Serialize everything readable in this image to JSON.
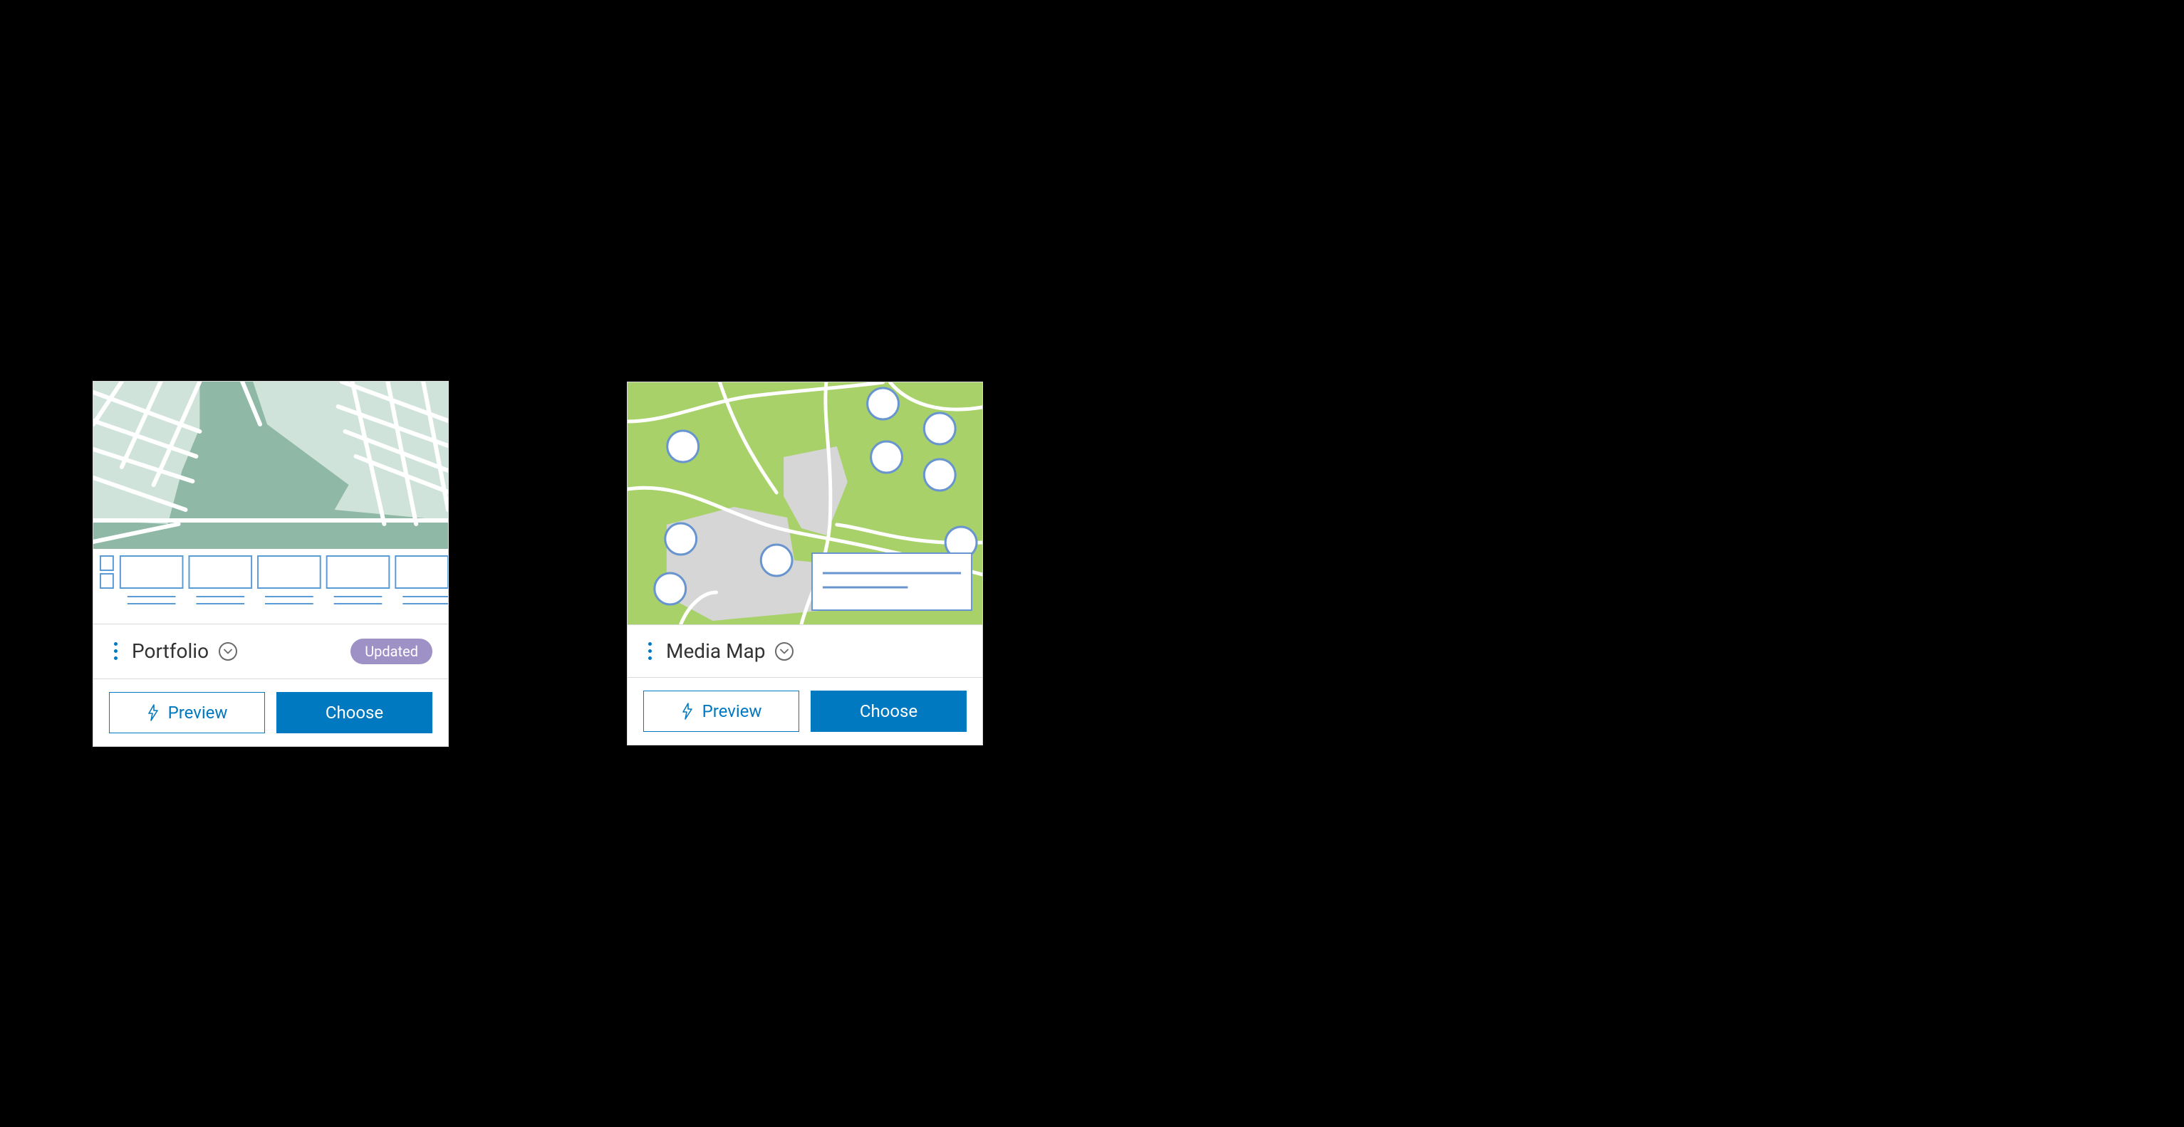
{
  "cards": [
    {
      "title": "Portfolio",
      "badge": "Updated",
      "preview_label": "Preview",
      "choose_label": "Choose"
    },
    {
      "title": "Media Map",
      "badge": null,
      "preview_label": "Preview",
      "choose_label": "Choose"
    }
  ],
  "colors": {
    "primary": "#0079c1",
    "badge_bg": "#9e91c6",
    "portfolio_map_light": "#cfe3da",
    "portfolio_map_dark": "#8fb8a6",
    "media_map_green": "#a8d16a",
    "media_map_grey": "#d6d6d6"
  }
}
